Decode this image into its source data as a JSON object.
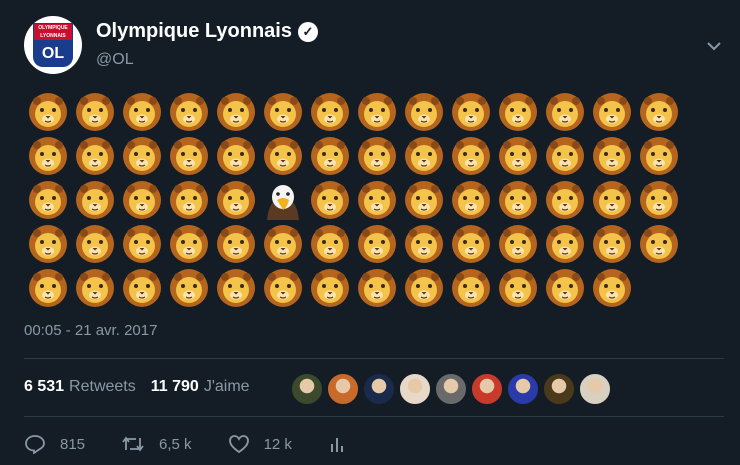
{
  "tweet": {
    "author_name": "Olympique Lyonnais",
    "handle": "@OL",
    "crest_text_top": "OLYMPIQUE LYONNAIS",
    "crest_text_bottom": "OL",
    "emoji_rows": [
      [
        "lion",
        "lion",
        "lion",
        "lion",
        "lion",
        "lion",
        "lion",
        "lion",
        "lion",
        "lion",
        "lion",
        "lion",
        "lion",
        "lion"
      ],
      [
        "lion",
        "lion",
        "lion",
        "lion",
        "lion",
        "lion",
        "lion",
        "lion",
        "lion",
        "lion",
        "lion",
        "lion",
        "lion",
        "lion"
      ],
      [
        "lion",
        "lion",
        "lion",
        "lion",
        "lion",
        "eagle",
        "lion",
        "lion",
        "lion",
        "lion",
        "lion",
        "lion",
        "lion",
        "lion"
      ],
      [
        "lion",
        "lion",
        "lion",
        "lion",
        "lion",
        "lion",
        "lion",
        "lion",
        "lion",
        "lion",
        "lion",
        "lion",
        "lion",
        "lion"
      ],
      [
        "lion",
        "lion",
        "lion",
        "lion",
        "lion",
        "lion",
        "lion",
        "lion",
        "lion",
        "lion",
        "lion",
        "lion",
        "lion"
      ]
    ],
    "timestamp": "00:05 - 21 avr. 2017",
    "retweets_count": "6 531",
    "retweets_label": "Retweets",
    "likes_count": "11 790",
    "likes_label": "J'aime",
    "liker_colors": [
      "#3a4a2a",
      "#c86a2a",
      "#1a2a4a",
      "#e8d8c8",
      "#6a6a6a",
      "#c83a2a",
      "#2a3aa8",
      "#4a3a1a",
      "#d8d0c0"
    ]
  },
  "actions": {
    "reply_count": "815",
    "retweet_count": "6,5 k",
    "like_count": "12 k"
  },
  "colors": {
    "background": "#141d26",
    "muted": "#8899a6",
    "lion_mane": "#b5651d",
    "lion_face": "#f4c34a"
  }
}
